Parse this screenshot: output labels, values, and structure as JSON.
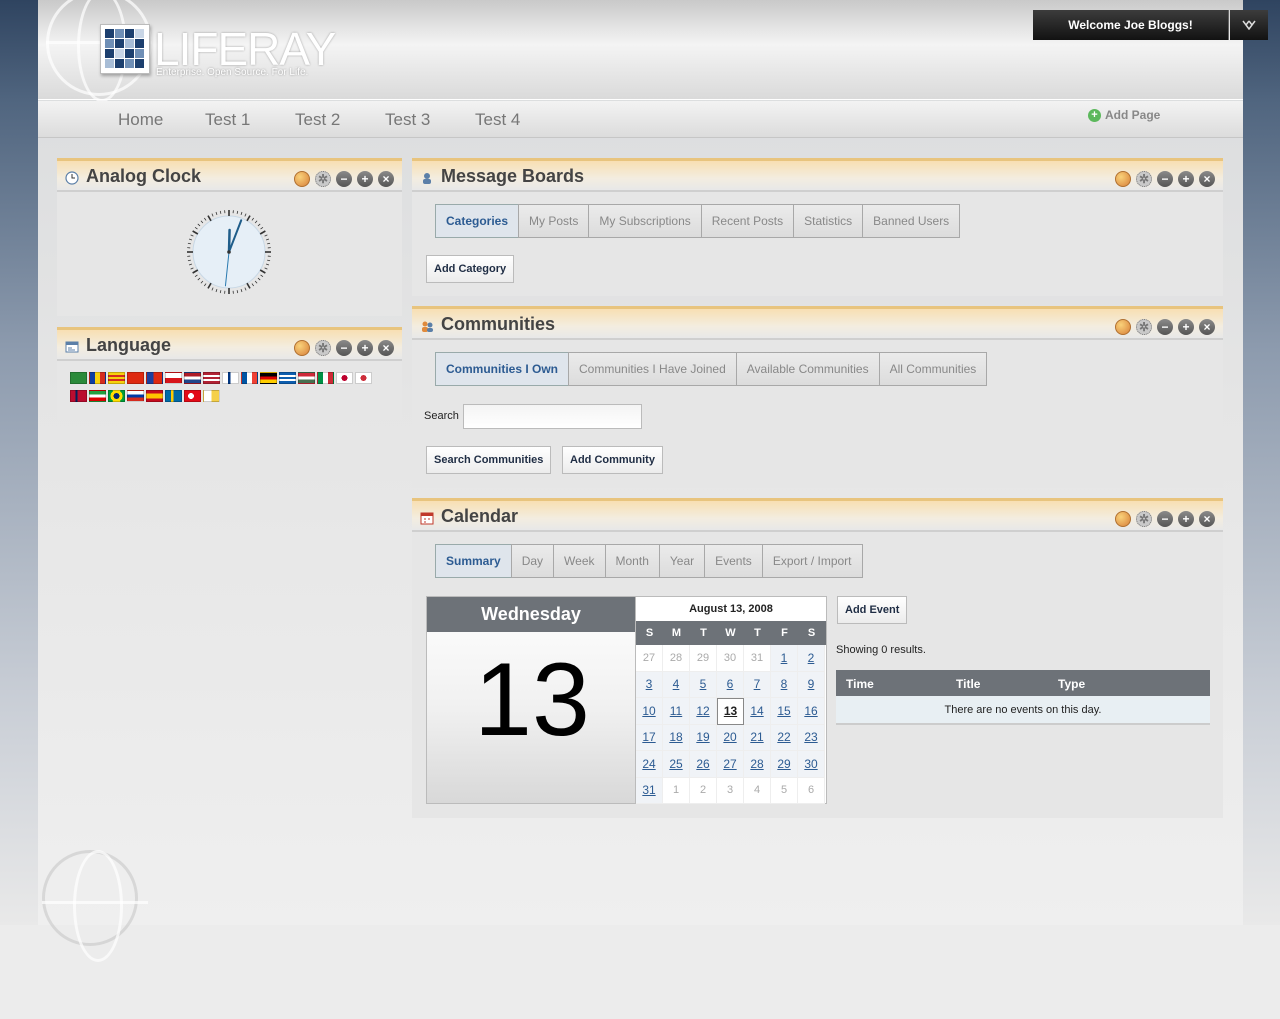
{
  "header": {
    "logo_text": "LIFERAY",
    "logo_tagline": "Enterprise. Open Source. For Life.",
    "welcome_label": "Welcome Joe Bloggs!",
    "welcome_dropdown_icon": "chevron-down-icon"
  },
  "nav": {
    "items": [
      "Home",
      "Test 1",
      "Test 2",
      "Test 3",
      "Test 4"
    ],
    "add_page_label": "Add Page"
  },
  "colors": {
    "portlet_title_accent": "#e8c47e",
    "active_tab_text": "#2c5b92",
    "table_header_bg": "#6d7278"
  },
  "analog_clock": {
    "title": "Analog Clock",
    "time_hours": 12,
    "time_minutes": 3,
    "time_seconds": 31
  },
  "language": {
    "title": "Language",
    "flag_count": 28
  },
  "message_boards": {
    "title": "Message Boards",
    "tabs": [
      "Categories",
      "My Posts",
      "My Subscriptions",
      "Recent Posts",
      "Statistics",
      "Banned Users"
    ],
    "active_tab": "Categories",
    "add_category_label": "Add Category"
  },
  "communities": {
    "title": "Communities",
    "tabs": [
      "Communities I Own",
      "Communities I Have Joined",
      "Available Communities",
      "All Communities"
    ],
    "active_tab": "Communities I Own",
    "search_label": "Search",
    "search_value": "",
    "search_button": "Search Communities",
    "add_button": "Add Community"
  },
  "calendar": {
    "title": "Calendar",
    "tabs": [
      "Summary",
      "Day",
      "Week",
      "Month",
      "Year",
      "Events",
      "Export / Import"
    ],
    "active_tab": "Summary",
    "day_name": "Wednesday",
    "day_number": "13",
    "mini_title": "August 13, 2008",
    "weekday_headers": [
      "S",
      "M",
      "T",
      "W",
      "T",
      "F",
      "S"
    ],
    "weeks": [
      [
        "27",
        "28",
        "29",
        "30",
        "31",
        "1",
        "2"
      ],
      [
        "3",
        "4",
        "5",
        "6",
        "7",
        "8",
        "9"
      ],
      [
        "10",
        "11",
        "12",
        "13",
        "14",
        "15",
        "16"
      ],
      [
        "17",
        "18",
        "19",
        "20",
        "21",
        "22",
        "23"
      ],
      [
        "24",
        "25",
        "26",
        "27",
        "28",
        "29",
        "30"
      ],
      [
        "31",
        "1",
        "2",
        "3",
        "4",
        "5",
        "6"
      ]
    ],
    "add_event_label": "Add Event",
    "results_text": "Showing 0 results.",
    "table_headers": [
      "Time",
      "Title",
      "Type"
    ],
    "empty_message": "There are no events on this day."
  }
}
